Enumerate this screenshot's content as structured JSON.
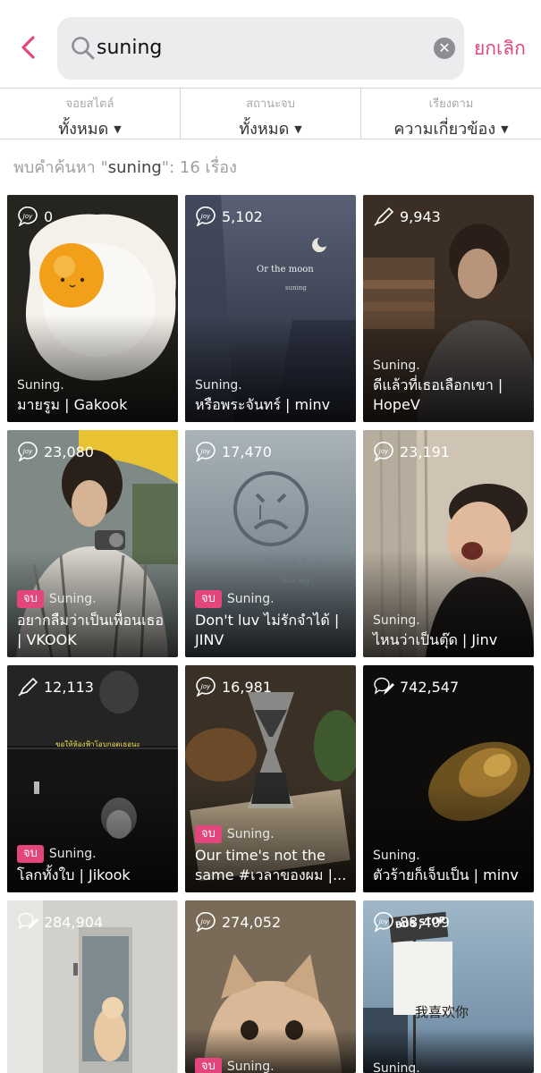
{
  "header": {
    "search_value": "suning",
    "cancel_label": "ยกเลิก"
  },
  "filters": [
    {
      "label": "จอยสไตล์",
      "value": "ทั้งหมด"
    },
    {
      "label": "สถานะจบ",
      "value": "ทั้งหมด"
    },
    {
      "label": "เรียงตาม",
      "value": "ความเกี่ยวข้อง"
    }
  ],
  "result": {
    "prefix": "พบคำค้นหา \"",
    "query": "suning",
    "suffix": "\": 16 เรื่อง"
  },
  "colors": {
    "accent": "#e2467c",
    "muted": "#a0a0a4"
  },
  "cards": [
    {
      "icon": "joy-icon",
      "count": "0",
      "badge": "",
      "author": "Suning.",
      "title": "มายรูม | Gakook"
    },
    {
      "icon": "joy-icon",
      "count": "5,102",
      "badge": "",
      "author": "Suning.",
      "title": "หรือพระจันทร์ | minv",
      "art_text": "Or the moon",
      "art_sub": "suning"
    },
    {
      "icon": "pen-icon",
      "count": "9,943",
      "badge": "",
      "author": "Suning.",
      "title": "ดีแล้วที่เธอเลือกเขา | HopeV"
    },
    {
      "icon": "joy-icon",
      "count": "23,080",
      "badge": "จบ",
      "author": "Suning.",
      "title": "อยากลืมว่าเป็นเพื่อนเธอ | VKOOK"
    },
    {
      "icon": "joy-icon",
      "count": "17,470",
      "badge": "จบ",
      "author": "Suning.",
      "title": "Don't luv ไม่รักจำได้ | JINV",
      "art_text": "Don't luv",
      "art_sub": "Sun ing."
    },
    {
      "icon": "joy-icon",
      "count": "23,191",
      "badge": "",
      "author": "Suning.",
      "title": "ไหนว่าเป็นตุ๊ด | Jinv"
    },
    {
      "icon": "pen-icon",
      "count": "12,113",
      "badge": "จบ",
      "author": "Suning.",
      "title": "โลกทั้งใบ | Jikook",
      "art_text": "ขอให้ห้องฟ้าโอบกอดเธอนะ"
    },
    {
      "icon": "joy-icon",
      "count": "16,981",
      "badge": "จบ",
      "author": "Suning.",
      "title": "Our time's not the same #เวลาของผม |..."
    },
    {
      "icon": "joy-pen-icon",
      "count": "742,547",
      "badge": "",
      "author": "Suning.",
      "title": "ตัวร้ายก็เจ็บเป็น | minv"
    },
    {
      "icon": "joy-pen-icon",
      "count": "284,904",
      "badge": "",
      "author": "",
      "title": ""
    },
    {
      "icon": "joy-icon",
      "count": "274,052",
      "badge": "จบ",
      "author": "Suning.",
      "title": ""
    },
    {
      "icon": "joy-icon",
      "count": "88,409",
      "badge": "",
      "author": "Suning.",
      "title": "",
      "art_sign": "BUS STOP",
      "art_text": "我喜欢你"
    }
  ]
}
